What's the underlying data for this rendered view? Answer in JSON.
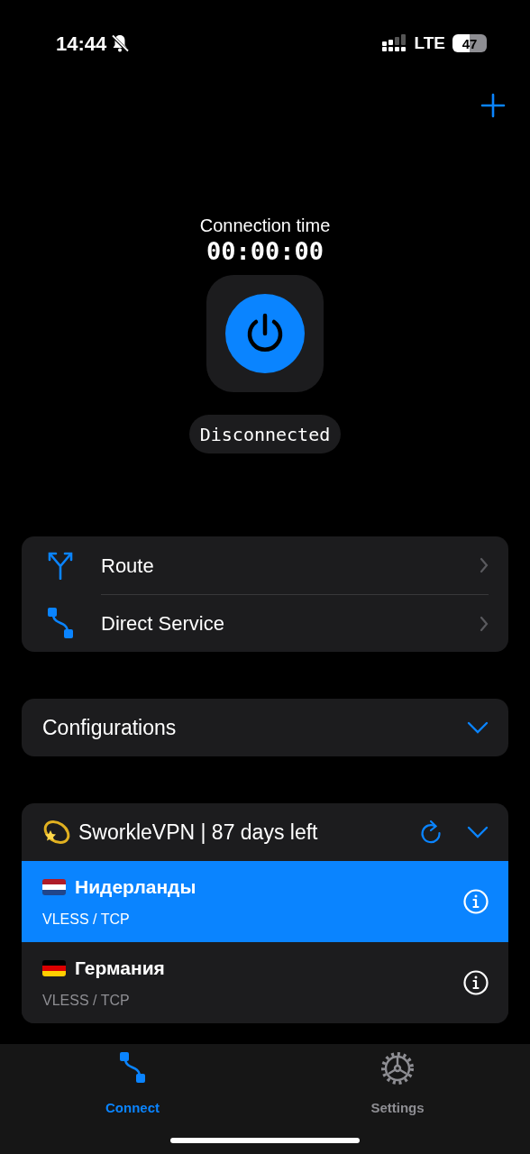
{
  "status_bar": {
    "time": "14:44",
    "network": "LTE",
    "battery": "47"
  },
  "connection": {
    "time_label": "Connection time",
    "time": "00:00:00",
    "status": "Disconnected"
  },
  "menu": [
    {
      "label": "Route",
      "kind": "route"
    },
    {
      "label": "Direct Service",
      "kind": "direct"
    }
  ],
  "configurations": {
    "title": "Configurations"
  },
  "subscription": {
    "title": "SworkleVPN | 87 days left",
    "servers": [
      {
        "name": "Нидерланды",
        "protocol": "VLESS / TCP",
        "selected": true,
        "kind": "netherlands"
      },
      {
        "name": "Германия",
        "protocol": "VLESS / TCP",
        "selected": false,
        "kind": "germany"
      }
    ]
  },
  "tab_bar": [
    {
      "label": "Connect",
      "kind": "connect",
      "selected": true
    },
    {
      "label": "Settings",
      "kind": "settings",
      "selected": false
    }
  ]
}
